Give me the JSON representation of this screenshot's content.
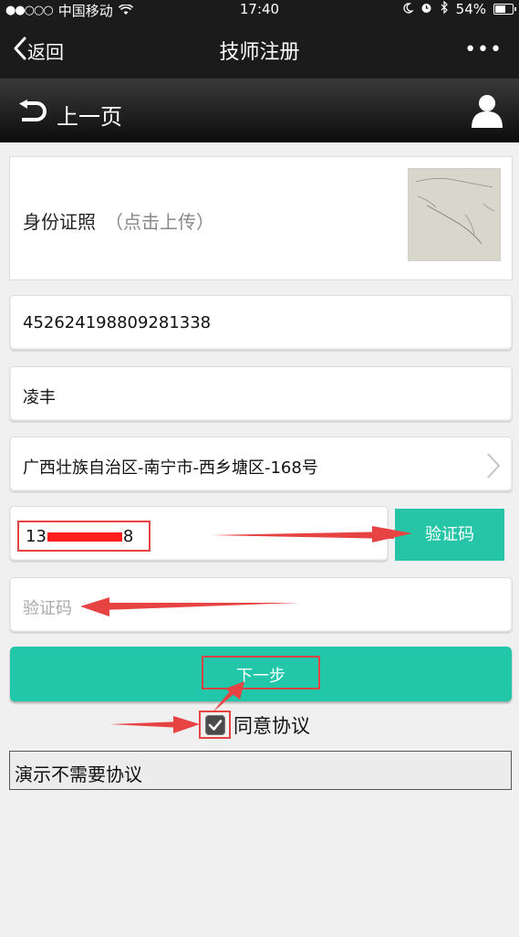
{
  "status_bar": {
    "signal": "●●○○○",
    "carrier": "中国移动",
    "time": "17:40",
    "battery": "54%",
    "battery_level": 0.54
  },
  "navbar": {
    "back_label": "返回",
    "title": "技师注册",
    "more_label": "•••"
  },
  "subheader": {
    "prev_label": "上一页"
  },
  "form": {
    "id_label": "身份证照",
    "id_hint": "（点击上传）",
    "id_number": "452624198809281338",
    "name": "凌丰",
    "address": "广西壮族自治区-南宁市-西乡塘区-168号",
    "phone_start": "13",
    "phone_end": "8",
    "code_button": "验证码",
    "code_placeholder": "验证码",
    "next_button": "下一步",
    "agree_label": "同意协议",
    "agree_checked": true,
    "demo_note": "演示不需要协议"
  },
  "colors": {
    "accent": "#22c7aa",
    "annotation": "#e84343",
    "header": "#1b1b1b"
  }
}
